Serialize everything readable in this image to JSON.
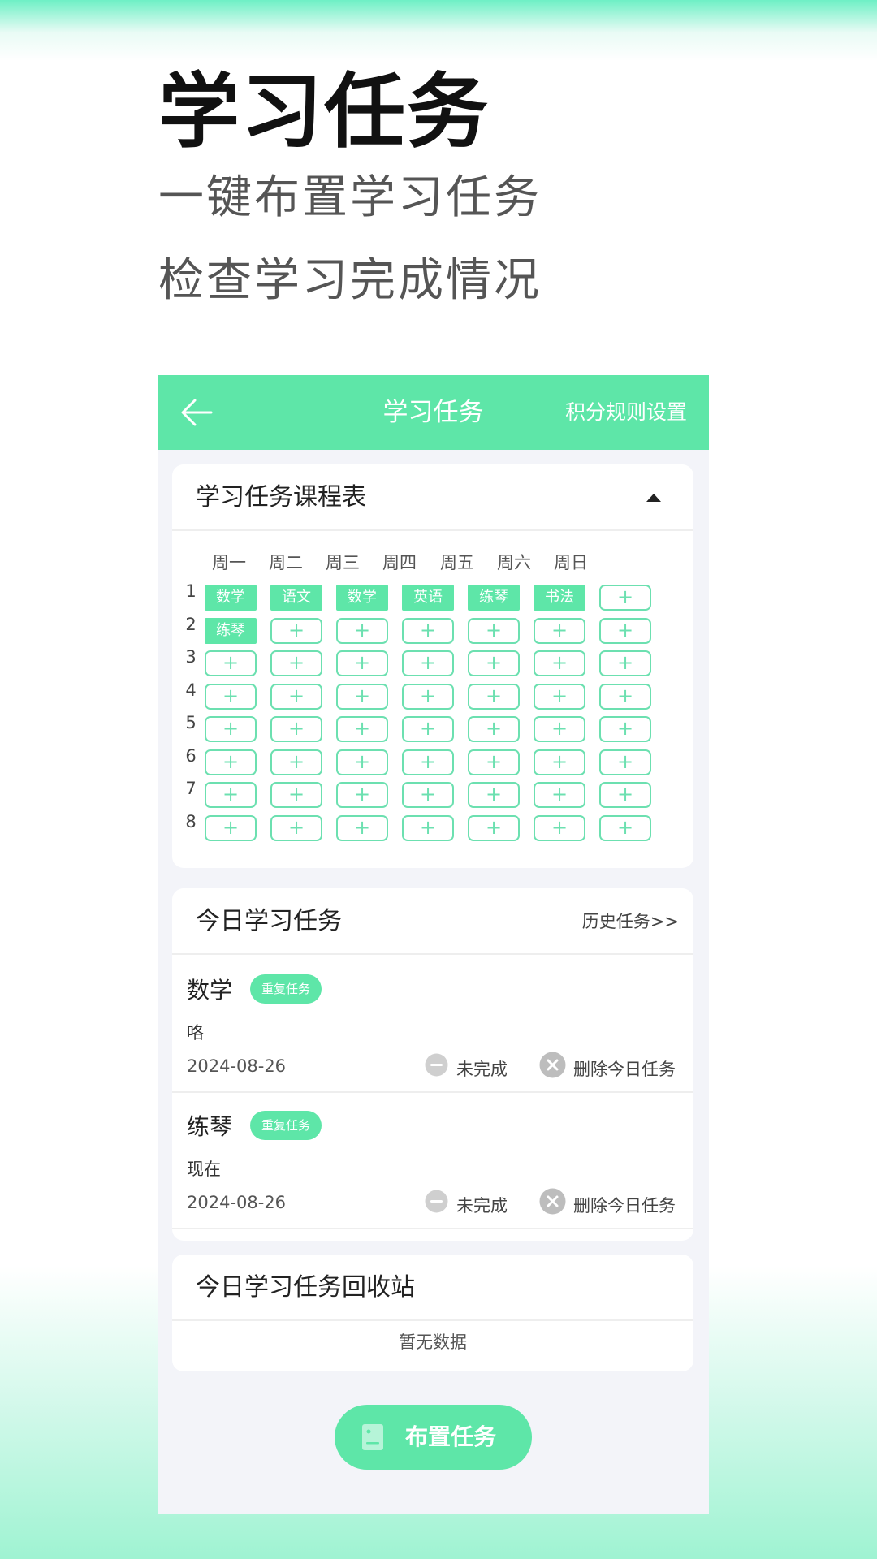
{
  "promo": {
    "title": "学习任务",
    "line1": "一键布置学习任务",
    "line2": "检查学习完成情况"
  },
  "appbar": {
    "title": "学习任务",
    "action": "积分规则设置"
  },
  "schedule": {
    "title": "学习任务课程表",
    "weekdays": [
      "周一",
      "周二",
      "周三",
      "周四",
      "周五",
      "周六",
      "周日"
    ],
    "empty_slot": "+",
    "rows": [
      {
        "num": "1",
        "cells": [
          "数学",
          "语文",
          "数学",
          "英语",
          "练琴",
          "书法",
          "+"
        ]
      },
      {
        "num": "2",
        "cells": [
          "练琴",
          "+",
          "+",
          "+",
          "+",
          "+",
          "+"
        ]
      },
      {
        "num": "3",
        "cells": [
          "+",
          "+",
          "+",
          "+",
          "+",
          "+",
          "+"
        ]
      },
      {
        "num": "4",
        "cells": [
          "+",
          "+",
          "+",
          "+",
          "+",
          "+",
          "+"
        ]
      },
      {
        "num": "5",
        "cells": [
          "+",
          "+",
          "+",
          "+",
          "+",
          "+",
          "+"
        ]
      },
      {
        "num": "6",
        "cells": [
          "+",
          "+",
          "+",
          "+",
          "+",
          "+",
          "+"
        ]
      },
      {
        "num": "7",
        "cells": [
          "+",
          "+",
          "+",
          "+",
          "+",
          "+",
          "+"
        ]
      },
      {
        "num": "8",
        "cells": [
          "+",
          "+",
          "+",
          "+",
          "+",
          "+",
          "+"
        ]
      }
    ]
  },
  "today": {
    "title": "今日学习任务",
    "history_link": "历史任务>>",
    "tasks": [
      {
        "name": "数学",
        "badge": "重复任务",
        "note": "咯",
        "date": "2024-08-26",
        "status": "未完成",
        "delete": "删除今日任务"
      },
      {
        "name": "练琴",
        "badge": "重复任务",
        "note": "现在",
        "date": "2024-08-26",
        "status": "未完成",
        "delete": "删除今日任务"
      }
    ]
  },
  "recycle": {
    "title": "今日学习任务回收站",
    "empty": "暂无数据"
  },
  "assign_button": {
    "label": "布置任务"
  },
  "colors": {
    "accent": "#5ee6a8",
    "outline": "#6ce0b0",
    "background": "#f3f4f9"
  }
}
